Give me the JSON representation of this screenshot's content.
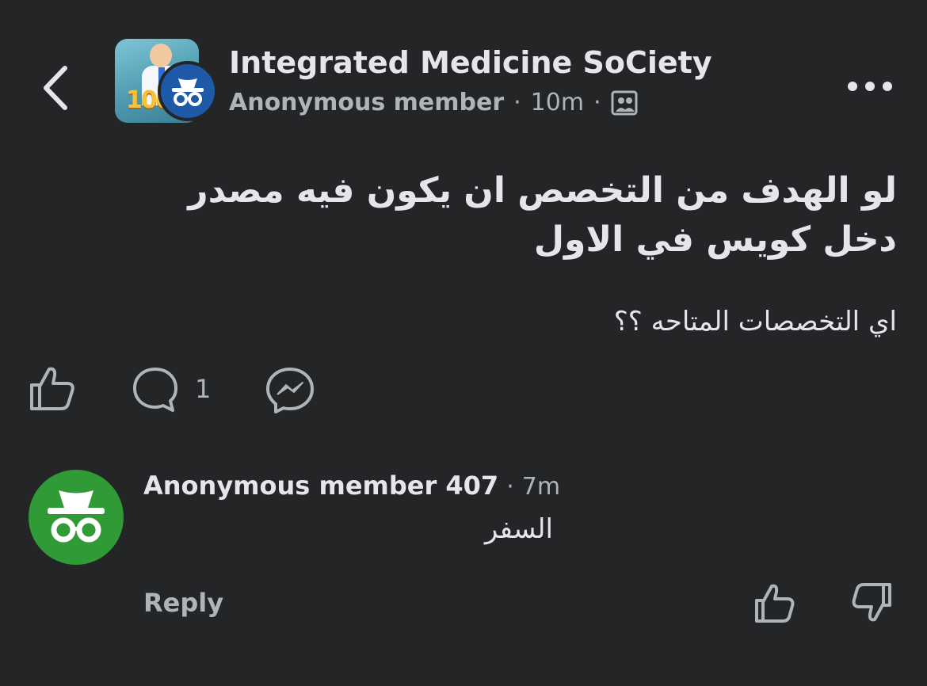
{
  "header": {
    "group_name": "Integrated Medicine SoCiety",
    "author": "Anonymous member",
    "separator": "·",
    "time": "10m",
    "icons": {
      "back": "chevron-left-icon",
      "more": "more-horizontal-icon",
      "audience": "group-members-icon",
      "anonymous": "incognito-icon"
    }
  },
  "post": {
    "title": "لو الهدف من التخصص ان يكون فيه مصدر دخل كويس في الاول",
    "body": "اي التخصصات المتاحه ؟؟"
  },
  "actions": {
    "comment_count": "1",
    "icons": [
      "like-icon",
      "comment-icon",
      "messenger-icon"
    ]
  },
  "comment": {
    "author": "Anonymous member 407",
    "separator": "·",
    "time": "7m",
    "text": "السفر",
    "reply_label": "Reply"
  },
  "colors": {
    "background": "#242526",
    "text": "#e4e6eb",
    "muted": "#b0b3b8",
    "anon_badge_blue": "#1e5aa8",
    "commenter_green": "#2f9a36"
  }
}
